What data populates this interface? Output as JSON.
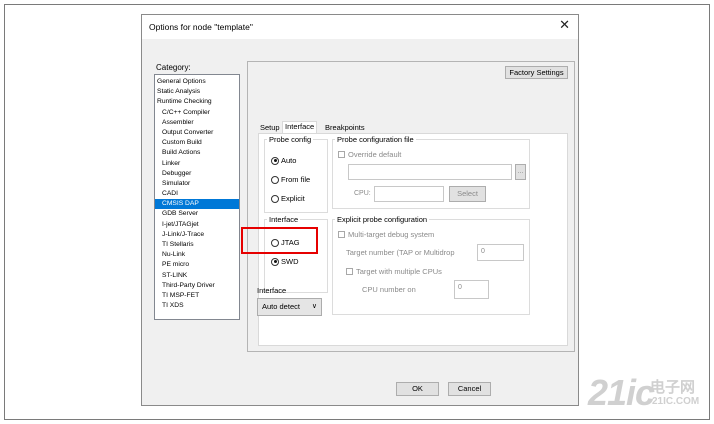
{
  "dialog": {
    "title": "Options for node \"template\"",
    "close_glyph": "✕"
  },
  "category": {
    "label": "Category:",
    "items": [
      {
        "label": "General Options",
        "sub": false,
        "selected": false
      },
      {
        "label": "Static Analysis",
        "sub": false,
        "selected": false
      },
      {
        "label": "Runtime Checking",
        "sub": false,
        "selected": false
      },
      {
        "label": "C/C++ Compiler",
        "sub": true,
        "selected": false
      },
      {
        "label": "Assembler",
        "sub": true,
        "selected": false
      },
      {
        "label": "Output Converter",
        "sub": true,
        "selected": false
      },
      {
        "label": "Custom Build",
        "sub": true,
        "selected": false
      },
      {
        "label": "Build Actions",
        "sub": true,
        "selected": false
      },
      {
        "label": "Linker",
        "sub": true,
        "selected": false
      },
      {
        "label": "Debugger",
        "sub": true,
        "selected": false
      },
      {
        "label": "Simulator",
        "sub": true,
        "selected": false
      },
      {
        "label": "CADI",
        "sub": true,
        "selected": false
      },
      {
        "label": "CMSIS DAP",
        "sub": true,
        "selected": true
      },
      {
        "label": "GDB Server",
        "sub": true,
        "selected": false
      },
      {
        "label": "I-jet/JTAGjet",
        "sub": true,
        "selected": false
      },
      {
        "label": "J-Link/J-Trace",
        "sub": true,
        "selected": false
      },
      {
        "label": "TI Stellaris",
        "sub": true,
        "selected": false
      },
      {
        "label": "Nu-Link",
        "sub": true,
        "selected": false
      },
      {
        "label": "PE micro",
        "sub": true,
        "selected": false
      },
      {
        "label": "ST-LINK",
        "sub": true,
        "selected": false
      },
      {
        "label": "Third-Party Driver",
        "sub": true,
        "selected": false
      },
      {
        "label": "TI MSP-FET",
        "sub": true,
        "selected": false
      },
      {
        "label": "TI XDS",
        "sub": true,
        "selected": false
      }
    ]
  },
  "factory_settings_label": "Factory Settings",
  "tabs": [
    "Setup",
    "Interface",
    "Breakpoints"
  ],
  "active_tab": "Interface",
  "probe_config": {
    "label": "Probe config",
    "options": [
      "Auto",
      "From file",
      "Explicit"
    ],
    "selected": "Auto"
  },
  "probe_config_file": {
    "label": "Probe configuration file",
    "override_label": "Override default",
    "path_value": "",
    "browse_label": "...",
    "cpu_label": "CPU:",
    "cpu_value": "",
    "select_label": "Select"
  },
  "interface_group": {
    "label": "Interface",
    "options": [
      "JTAG",
      "SWD"
    ],
    "selected": "SWD"
  },
  "explicit_probe": {
    "label": "Explicit probe configuration",
    "multi_target_label": "Multi-target debug system",
    "target_number_label": "Target number (TAP or Multidrop",
    "target_number_value": "0",
    "multi_cpu_label": "Target with multiple CPUs",
    "cpu_number_label": "CPU number on",
    "cpu_number_value": "0"
  },
  "interface_select": {
    "label": "Interface",
    "value": "Auto detect",
    "chevron": "∨"
  },
  "buttons": {
    "ok": "OK",
    "cancel": "Cancel"
  },
  "watermark": {
    "main": "21ic",
    "cn": "电子网",
    "sub": "21IC.COM"
  }
}
